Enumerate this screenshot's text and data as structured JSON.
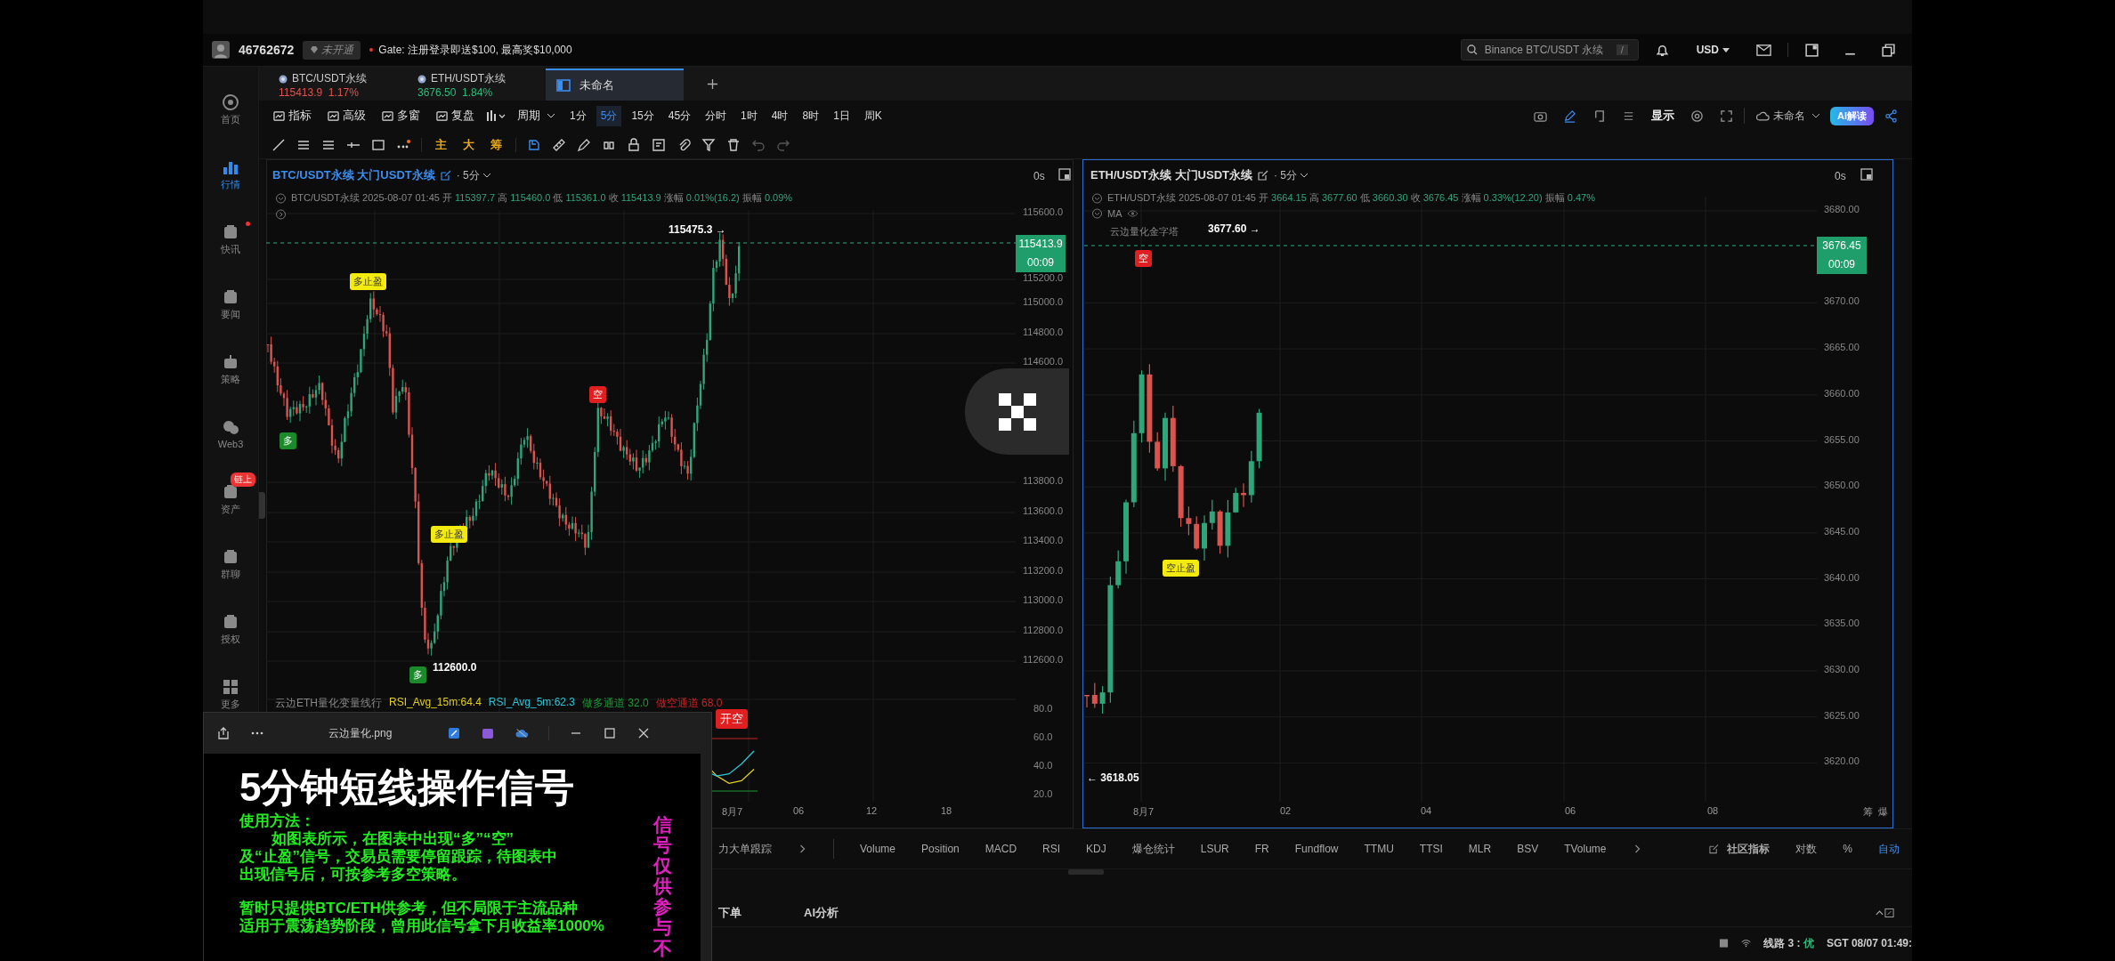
{
  "header": {
    "account_id": "46762672",
    "vip_badge": "未开通",
    "promo": "Gate: 注册登录即送$100, 最高奖$10,000",
    "search_placeholder": "Binance BTC/USDT 永续",
    "search_shortcut": "/",
    "currency": "USD"
  },
  "tabs": [
    {
      "kind": "ticker",
      "symbol": "BTC/USDT永续",
      "price": "115413.9",
      "change": "1.17%",
      "color": "#e0524f",
      "selected": false
    },
    {
      "kind": "ticker",
      "symbol": "ETH/USDT永续",
      "price": "3676.50",
      "change": "1.84%",
      "color": "#2fb87a",
      "selected": false
    },
    {
      "kind": "layout",
      "name": "未命名",
      "selected": true
    }
  ],
  "sidebar": [
    {
      "label": "首页",
      "selected": false
    },
    {
      "label": "行情",
      "selected": true
    },
    {
      "label": "快讯",
      "selected": false,
      "dot": true
    },
    {
      "label": "要闻",
      "selected": false
    },
    {
      "label": "策略",
      "selected": false
    },
    {
      "label": "Web3",
      "selected": false
    },
    {
      "label": "资产",
      "selected": false,
      "badge": "链上"
    },
    {
      "label": "群聊",
      "selected": false
    },
    {
      "label": "授权",
      "selected": false
    },
    {
      "label": "更多",
      "selected": false
    }
  ],
  "toolbar": {
    "tools": [
      "指标",
      "高级",
      "多窗",
      "复盘"
    ],
    "period_label": "周期",
    "periods": [
      {
        "label": "1分",
        "selected": false
      },
      {
        "label": "5分",
        "selected": true
      },
      {
        "label": "15分",
        "selected": false
      },
      {
        "label": "45分",
        "selected": false
      },
      {
        "label": "分时",
        "selected": false
      },
      {
        "label": "1时",
        "selected": false
      },
      {
        "label": "4时",
        "selected": false
      },
      {
        "label": "8时",
        "selected": false
      },
      {
        "label": "1日",
        "selected": false
      },
      {
        "label": "周K",
        "selected": false
      }
    ],
    "display": "显示",
    "layout_name": "未命名",
    "ai_button": "AI解读"
  },
  "drawing_marks": [
    "主",
    "大",
    "筹"
  ],
  "charts": [
    {
      "selected": false,
      "title": "BTC/USDT永续",
      "market": "大门USDT永续",
      "interval": "· 5分",
      "timer": "0s",
      "ohlc": {
        "symbol": "BTC/USDT永续",
        "time": "2025-08-07 01:45",
        "open_label": "开",
        "open": "115397.7",
        "high_label": "高",
        "high": "115460.0",
        "low_label": "低",
        "low": "115361.0",
        "close_label": "收",
        "close": "115413.9",
        "change_label": "涨幅",
        "change": "0.01%(16.2)",
        "amp_label": "振幅",
        "amp": "0.09%"
      },
      "yaxis": [
        "115600.0",
        "115200.0",
        "115000.0",
        "114800.0",
        "114600.0",
        "113800.0",
        "113600.0",
        "113400.0",
        "113200.0",
        "113000.0",
        "112800.0",
        "112600.0"
      ],
      "last_price": "115413.9",
      "countdown": "00:09",
      "high_mark": "115475.3 →",
      "low_mark": "112600.0",
      "signals": [
        {
          "kind": "take-profit",
          "text": "多止盈"
        },
        {
          "kind": "long",
          "text": "多"
        },
        {
          "kind": "short",
          "text": "空"
        },
        {
          "kind": "take-profit",
          "text": "多止盈"
        },
        {
          "kind": "long",
          "text": "多"
        }
      ],
      "indicator": {
        "name": "云边ETH量化变量线行",
        "values": [
          {
            "text": "RSI_Avg_15m:64.4",
            "color": "#e3d01c"
          },
          {
            "text": "RSI_Avg_5m:62.3",
            "color": "#2ec5d6"
          },
          {
            "text": "做多通道 32.0",
            "color": "#1c9a35"
          },
          {
            "text": "做空通道 68.0",
            "color": "#cc2222"
          }
        ],
        "axis": [
          "80.0",
          "60.0",
          "40.0",
          "20.0"
        ],
        "signal": "开空"
      },
      "xaxis": [
        "8月7",
        "06",
        "12",
        "18"
      ]
    },
    {
      "selected": true,
      "title": "ETH/USDT永续",
      "market": "大门USDT永续",
      "interval": "· 5分",
      "timer": "0s",
      "ohlc": {
        "symbol": "ETH/USDT永续",
        "time": "2025-08-07 01:45",
        "open_label": "开",
        "open": "3664.15",
        "high_label": "高",
        "high": "3677.60",
        "low_label": "低",
        "low": "3660.30",
        "close_label": "收",
        "close": "3676.45",
        "change_label": "涨幅",
        "change": "0.33%(12.20)",
        "amp_label": "振幅",
        "amp": "0.47%"
      },
      "ma_label": "MA",
      "strategy": "云边量化金字塔",
      "yaxis": [
        "3680.00",
        "3670.00",
        "3665.00",
        "3660.00",
        "3655.00",
        "3650.00",
        "3645.00",
        "3640.00",
        "3635.00",
        "3630.00",
        "3625.00",
        "3620.00"
      ],
      "last_price": "3676.45",
      "countdown": "00:09",
      "high_mark": "3677.60 →",
      "low_mark": "← 3618.05",
      "signals": [
        {
          "kind": "short",
          "text": "空"
        },
        {
          "kind": "take-profit",
          "text": "空止盈"
        }
      ],
      "xaxis": [
        "8月7",
        "02",
        "04",
        "06",
        "08"
      ],
      "corner": [
        "筹",
        "爆"
      ]
    }
  ],
  "indicator_bar": {
    "lead": "力大单跟踪",
    "items": [
      "Volume",
      "Position",
      "MACD",
      "RSI",
      "KDJ",
      "爆仓统计",
      "LSUR",
      "FR",
      "Fundflow",
      "TTMU",
      "TTSI",
      "MLR",
      "BSV",
      "TVolume"
    ],
    "community": "社区指标",
    "scales": [
      {
        "label": "对数",
        "selected": false
      },
      {
        "label": "%",
        "selected": false
      },
      {
        "label": "自动",
        "selected": true
      }
    ]
  },
  "bottom_tabs": [
    {
      "label": "下单",
      "selected": false
    },
    {
      "label": "AI分析",
      "selected": false
    }
  ],
  "status": {
    "line": "线路 3 :",
    "quality": "优",
    "time": "SGT 08/07 01:49:"
  },
  "viewer": {
    "title": "云边量化.png",
    "heading": "5分钟短线操作信号",
    "usage": "使用方法：",
    "lines": [
      {
        "text": "如图表所示，在图表中出现“多”“空”",
        "indent": true
      },
      {
        "text": "及“止盈”信号，交易员需要停留跟踪，待图表中",
        "indent": false
      },
      {
        "text": "出现信号后，可按参考多空策略。",
        "indent": false
      }
    ],
    "notes": [
      "暂时只提供BTC/ETH供参考，但不局限于主流品种",
      "适用于震荡趋势阶段，曾用此信号拿下月收益率1000%"
    ],
    "side_note": "信号仅供参与不"
  }
}
